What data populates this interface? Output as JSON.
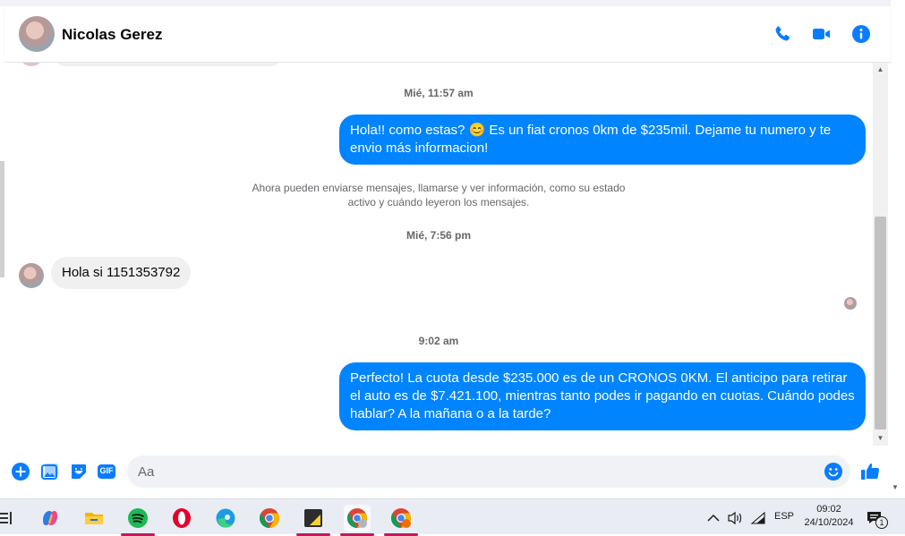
{
  "header": {
    "contact_name": "Nicolas Gerez",
    "actions": [
      "phone-icon",
      "video-icon",
      "info-icon"
    ]
  },
  "conversation": {
    "timestamp_1": "Mié, 11:57 am",
    "message_1": "Hola!! como estas? 😊 Es un fiat cronos 0km de $235mil. Dejame tu numero y te envio más informacion!",
    "notice": "Ahora pueden enviarse mensajes, llamarse y ver información, como su estado activo y cuándo leyeron los mensajes.",
    "timestamp_2": "Mié, 7:56 pm",
    "message_2": "Hola si 1151353792",
    "timestamp_3": "9:02 am",
    "message_3": "Perfecto! La cuota desde $235.000 es de un CRONOS 0KM. El anticipo para retirar el auto es de $7.421.100, mientras tanto podes ir pagando en cuotas. Cuándo podes hablar? A la mañana o a la tarde?"
  },
  "composer": {
    "placeholder": "Aa",
    "gif_label": "GIF"
  },
  "taskbar": {
    "language": "ESP",
    "time": "09:02",
    "date": "24/10/2024",
    "notification_count": "1"
  },
  "colors": {
    "accent": "#0084ff",
    "incoming_bubble": "#f0f0f0",
    "icon_blue": "#0a7cff"
  }
}
